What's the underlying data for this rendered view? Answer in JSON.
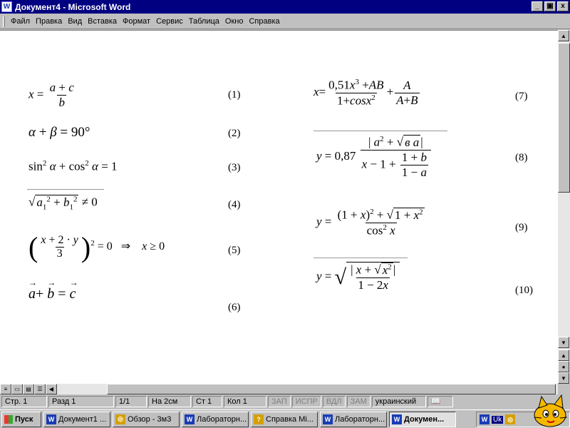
{
  "window": {
    "title": "Документ4 - Microsoft Word",
    "btn_min": "_",
    "btn_max": "▣",
    "btn_close": "x"
  },
  "menu": [
    "Файл",
    "Правка",
    "Вид",
    "Вставка",
    "Формат",
    "Сервис",
    "Таблица",
    "Окно",
    "Справка"
  ],
  "equations": {
    "n1": "(1)",
    "n2": "(2)",
    "n3": "(3)",
    "n4": "(4)",
    "n5": "(5)",
    "n6": "(6)",
    "n7": "(7)",
    "n8": "(8)",
    "n9": "(9)",
    "n10": "(10)"
  },
  "status": {
    "page": "Стр. 1",
    "section": "Разд 1",
    "pages": "1/1",
    "at": "На 2см",
    "line": "Ст 1",
    "col": "Кол 1",
    "rec": "ЗАП",
    "trk": "ИСПР",
    "ext": "ВДЛ",
    "ovr": "ЗАМ",
    "language": "украинский"
  },
  "taskbar": {
    "start": "Пуск",
    "tasks": [
      "Документ1 ...",
      "Обзор - 3м3",
      "Лабораторн...",
      "Справка Mi...",
      "Лабораторн...",
      "Докумен..."
    ],
    "lang": "Uk"
  }
}
